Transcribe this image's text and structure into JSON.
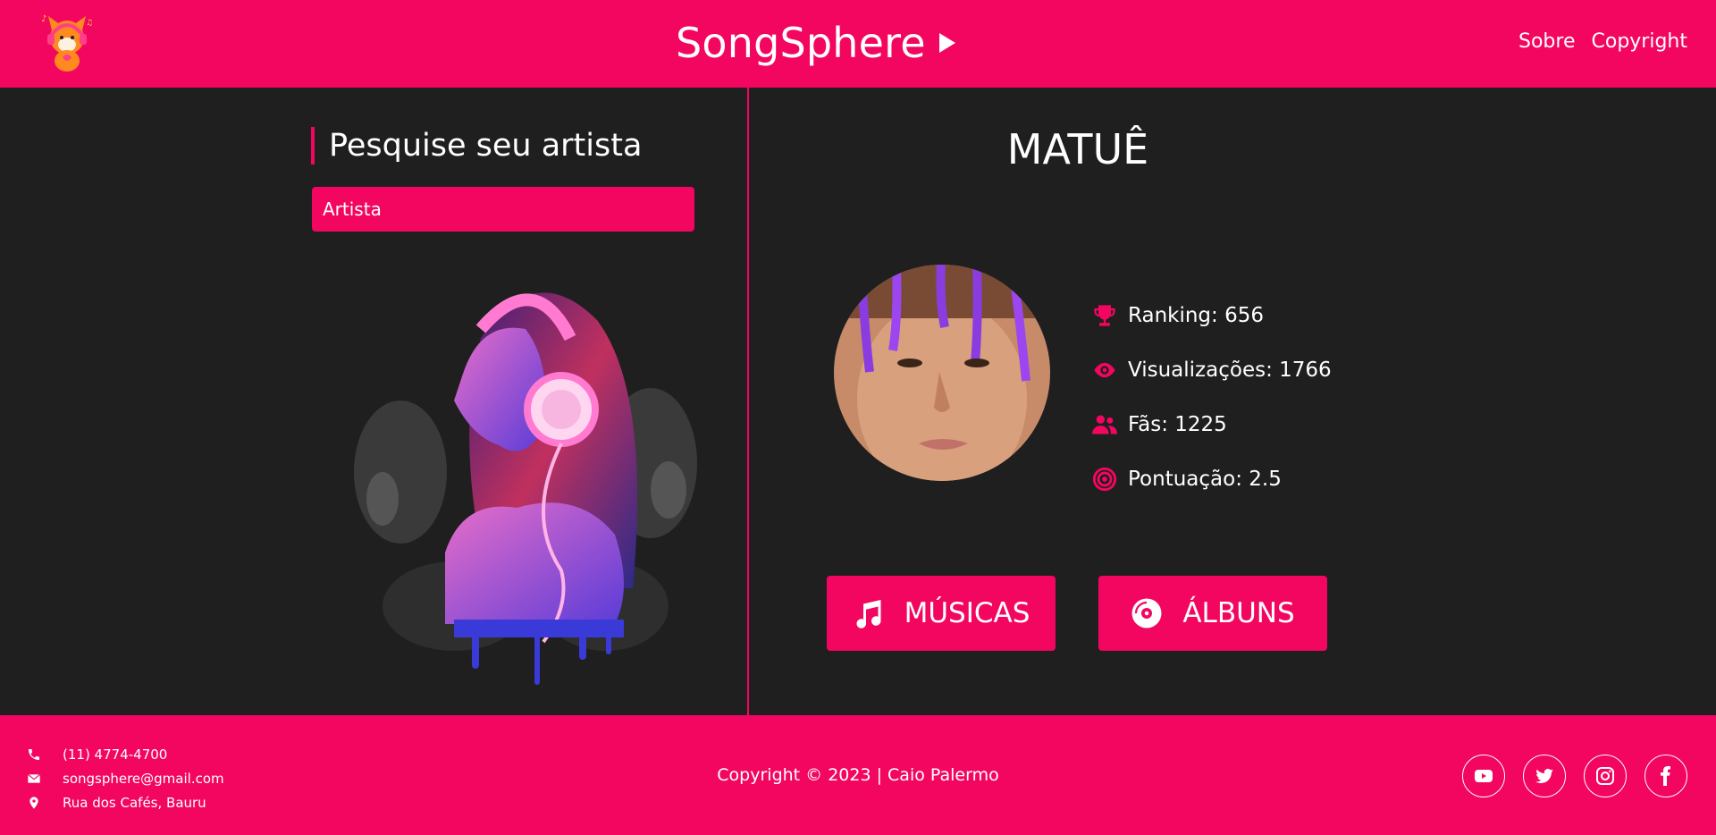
{
  "header": {
    "title": "SongSphere",
    "nav": [
      {
        "label": "Sobre"
      },
      {
        "label": "Copyright"
      }
    ]
  },
  "search": {
    "title": "Pesquise seu artista",
    "placeholder": "Artista",
    "value": ""
  },
  "artist": {
    "name": "MATUÊ",
    "stats": [
      {
        "icon": "trophy-icon",
        "label": "Ranking: 656"
      },
      {
        "icon": "eye-icon",
        "label": "Visualizações: 1766"
      },
      {
        "icon": "users-icon",
        "label": "Fãs: 1225"
      },
      {
        "icon": "target-icon",
        "label": "Pontuação: 2.5"
      }
    ]
  },
  "buttons": {
    "musicas": "MÚSICAS",
    "albuns": "ÁLBUNS"
  },
  "footer": {
    "phone": "(11) 4774-4700",
    "email": "songsphere@gmail.com",
    "address": "Rua dos Cafés, Bauru",
    "copyright": "Copyright © 2023 | Caio Palermo",
    "socials": [
      "youtube-icon",
      "twitter-icon",
      "instagram-icon",
      "facebook-icon"
    ]
  },
  "colors": {
    "accent": "#f30660",
    "background": "#1f1f1f",
    "text": "#ffffff"
  }
}
